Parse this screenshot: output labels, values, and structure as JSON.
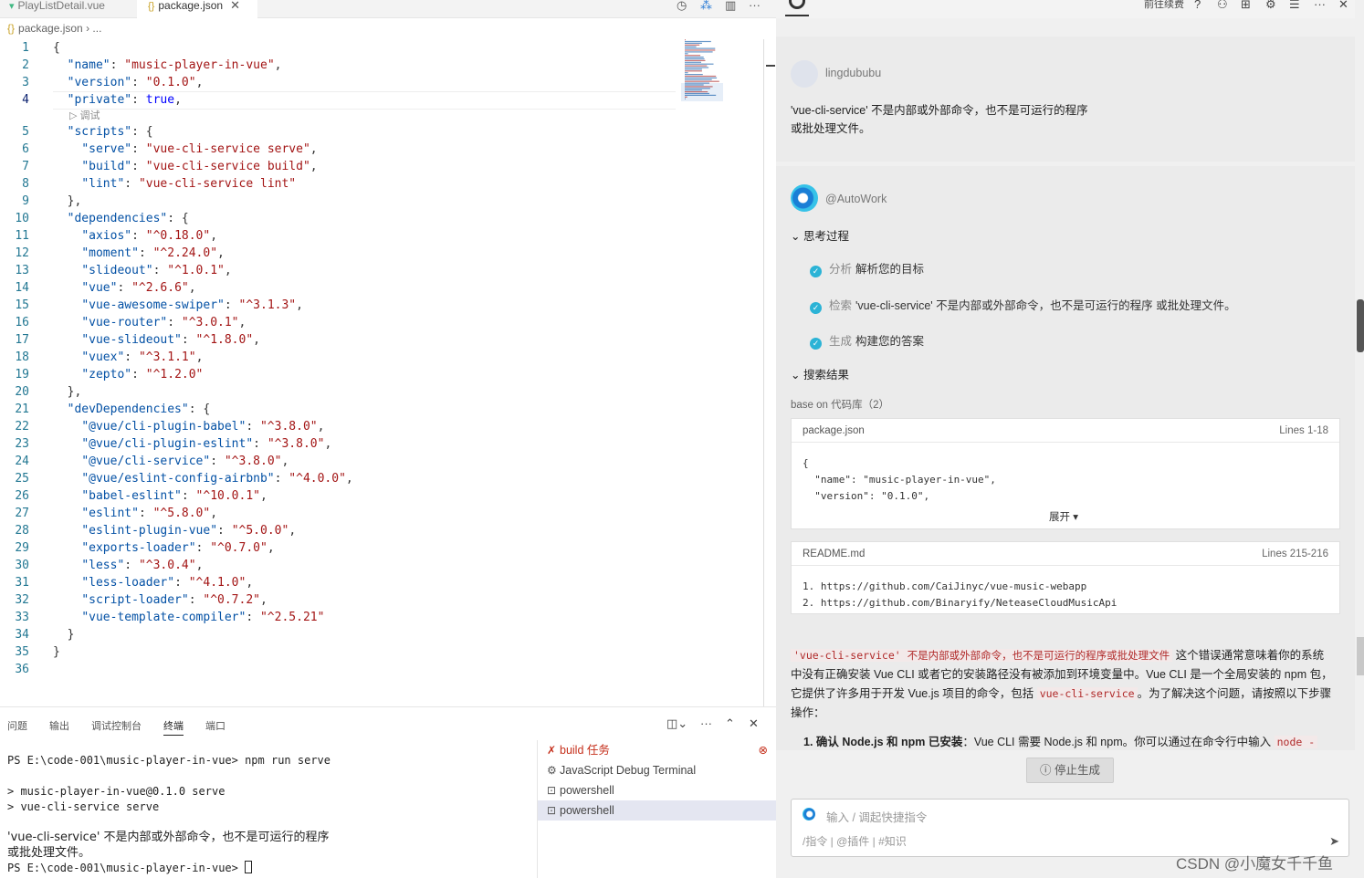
{
  "editor": {
    "tabs": [
      {
        "label": "PlayListDetail.vue",
        "icon": "vue-file-icon"
      },
      {
        "label": "package.json",
        "icon": "json-file-icon",
        "active": true
      }
    ],
    "breadcrumb": {
      "file": "package.json",
      "rest": "..."
    },
    "codelens": "调试",
    "lines": [
      {
        "n": "1",
        "parts": [
          [
            "p",
            "{"
          ]
        ]
      },
      {
        "n": "2",
        "parts": [
          [
            "p",
            "  "
          ],
          [
            "k",
            "\"name\""
          ],
          [
            "p",
            ": "
          ],
          [
            "s",
            "\"music-player-in-vue\""
          ],
          [
            "p",
            ","
          ]
        ]
      },
      {
        "n": "3",
        "parts": [
          [
            "p",
            "  "
          ],
          [
            "k",
            "\"version\""
          ],
          [
            "p",
            ": "
          ],
          [
            "s",
            "\"0.1.0\""
          ],
          [
            "p",
            ","
          ]
        ]
      },
      {
        "n": "4",
        "parts": [
          [
            "p",
            "  "
          ],
          [
            "k",
            "\"private\""
          ],
          [
            "p",
            ": "
          ],
          [
            "v",
            "true"
          ],
          [
            "p",
            ","
          ]
        ]
      },
      {
        "n": "5",
        "parts": [
          [
            "p",
            "  "
          ],
          [
            "k",
            "\"scripts\""
          ],
          [
            "p",
            ": {"
          ]
        ]
      },
      {
        "n": "6",
        "parts": [
          [
            "p",
            "    "
          ],
          [
            "k",
            "\"serve\""
          ],
          [
            "p",
            ": "
          ],
          [
            "s",
            "\"vue-cli-service serve\""
          ],
          [
            "p",
            ","
          ]
        ]
      },
      {
        "n": "7",
        "parts": [
          [
            "p",
            "    "
          ],
          [
            "k",
            "\"build\""
          ],
          [
            "p",
            ": "
          ],
          [
            "s",
            "\"vue-cli-service build\""
          ],
          [
            "p",
            ","
          ]
        ]
      },
      {
        "n": "8",
        "parts": [
          [
            "p",
            "    "
          ],
          [
            "k",
            "\"lint\""
          ],
          [
            "p",
            ": "
          ],
          [
            "s",
            "\"vue-cli-service lint\""
          ]
        ]
      },
      {
        "n": "9",
        "parts": [
          [
            "p",
            "  },"
          ]
        ]
      },
      {
        "n": "10",
        "parts": [
          [
            "p",
            "  "
          ],
          [
            "k",
            "\"dependencies\""
          ],
          [
            "p",
            ": {"
          ]
        ]
      },
      {
        "n": "11",
        "parts": [
          [
            "p",
            "    "
          ],
          [
            "k",
            "\"axios\""
          ],
          [
            "p",
            ": "
          ],
          [
            "s",
            "\"^0.18.0\""
          ],
          [
            "p",
            ","
          ]
        ]
      },
      {
        "n": "12",
        "parts": [
          [
            "p",
            "    "
          ],
          [
            "k",
            "\"moment\""
          ],
          [
            "p",
            ": "
          ],
          [
            "s",
            "\"^2.24.0\""
          ],
          [
            "p",
            ","
          ]
        ]
      },
      {
        "n": "13",
        "parts": [
          [
            "p",
            "    "
          ],
          [
            "k",
            "\"slideout\""
          ],
          [
            "p",
            ": "
          ],
          [
            "s",
            "\"^1.0.1\""
          ],
          [
            "p",
            ","
          ]
        ]
      },
      {
        "n": "14",
        "parts": [
          [
            "p",
            "    "
          ],
          [
            "k",
            "\"vue\""
          ],
          [
            "p",
            ": "
          ],
          [
            "s",
            "\"^2.6.6\""
          ],
          [
            "p",
            ","
          ]
        ]
      },
      {
        "n": "15",
        "parts": [
          [
            "p",
            "    "
          ],
          [
            "k",
            "\"vue-awesome-swiper\""
          ],
          [
            "p",
            ": "
          ],
          [
            "s",
            "\"^3.1.3\""
          ],
          [
            "p",
            ","
          ]
        ]
      },
      {
        "n": "16",
        "parts": [
          [
            "p",
            "    "
          ],
          [
            "k",
            "\"vue-router\""
          ],
          [
            "p",
            ": "
          ],
          [
            "s",
            "\"^3.0.1\""
          ],
          [
            "p",
            ","
          ]
        ]
      },
      {
        "n": "17",
        "parts": [
          [
            "p",
            "    "
          ],
          [
            "k",
            "\"vue-slideout\""
          ],
          [
            "p",
            ": "
          ],
          [
            "s",
            "\"^1.8.0\""
          ],
          [
            "p",
            ","
          ]
        ]
      },
      {
        "n": "18",
        "parts": [
          [
            "p",
            "    "
          ],
          [
            "k",
            "\"vuex\""
          ],
          [
            "p",
            ": "
          ],
          [
            "s",
            "\"^3.1.1\""
          ],
          [
            "p",
            ","
          ]
        ]
      },
      {
        "n": "19",
        "parts": [
          [
            "p",
            "    "
          ],
          [
            "k",
            "\"zepto\""
          ],
          [
            "p",
            ": "
          ],
          [
            "s",
            "\"^1.2.0\""
          ]
        ]
      },
      {
        "n": "20",
        "parts": [
          [
            "p",
            "  },"
          ]
        ]
      },
      {
        "n": "21",
        "parts": [
          [
            "p",
            "  "
          ],
          [
            "k",
            "\"devDependencies\""
          ],
          [
            "p",
            ": {"
          ]
        ]
      },
      {
        "n": "22",
        "parts": [
          [
            "p",
            "    "
          ],
          [
            "k",
            "\"@vue/cli-plugin-babel\""
          ],
          [
            "p",
            ": "
          ],
          [
            "s",
            "\"^3.8.0\""
          ],
          [
            "p",
            ","
          ]
        ]
      },
      {
        "n": "23",
        "parts": [
          [
            "p",
            "    "
          ],
          [
            "k",
            "\"@vue/cli-plugin-eslint\""
          ],
          [
            "p",
            ": "
          ],
          [
            "s",
            "\"^3.8.0\""
          ],
          [
            "p",
            ","
          ]
        ]
      },
      {
        "n": "24",
        "parts": [
          [
            "p",
            "    "
          ],
          [
            "k",
            "\"@vue/cli-service\""
          ],
          [
            "p",
            ": "
          ],
          [
            "s",
            "\"^3.8.0\""
          ],
          [
            "p",
            ","
          ]
        ]
      },
      {
        "n": "25",
        "parts": [
          [
            "p",
            "    "
          ],
          [
            "k",
            "\"@vue/eslint-config-airbnb\""
          ],
          [
            "p",
            ": "
          ],
          [
            "s",
            "\"^4.0.0\""
          ],
          [
            "p",
            ","
          ]
        ]
      },
      {
        "n": "26",
        "parts": [
          [
            "p",
            "    "
          ],
          [
            "k",
            "\"babel-eslint\""
          ],
          [
            "p",
            ": "
          ],
          [
            "s",
            "\"^10.0.1\""
          ],
          [
            "p",
            ","
          ]
        ]
      },
      {
        "n": "27",
        "parts": [
          [
            "p",
            "    "
          ],
          [
            "k",
            "\"eslint\""
          ],
          [
            "p",
            ": "
          ],
          [
            "s",
            "\"^5.8.0\""
          ],
          [
            "p",
            ","
          ]
        ]
      },
      {
        "n": "28",
        "parts": [
          [
            "p",
            "    "
          ],
          [
            "k",
            "\"eslint-plugin-vue\""
          ],
          [
            "p",
            ": "
          ],
          [
            "s",
            "\"^5.0.0\""
          ],
          [
            "p",
            ","
          ]
        ]
      },
      {
        "n": "29",
        "parts": [
          [
            "p",
            "    "
          ],
          [
            "k",
            "\"exports-loader\""
          ],
          [
            "p",
            ": "
          ],
          [
            "s",
            "\"^0.7.0\""
          ],
          [
            "p",
            ","
          ]
        ]
      },
      {
        "n": "30",
        "parts": [
          [
            "p",
            "    "
          ],
          [
            "k",
            "\"less\""
          ],
          [
            "p",
            ": "
          ],
          [
            "s",
            "\"^3.0.4\""
          ],
          [
            "p",
            ","
          ]
        ]
      },
      {
        "n": "31",
        "parts": [
          [
            "p",
            "    "
          ],
          [
            "k",
            "\"less-loader\""
          ],
          [
            "p",
            ": "
          ],
          [
            "s",
            "\"^4.1.0\""
          ],
          [
            "p",
            ","
          ]
        ]
      },
      {
        "n": "32",
        "parts": [
          [
            "p",
            "    "
          ],
          [
            "k",
            "\"script-loader\""
          ],
          [
            "p",
            ": "
          ],
          [
            "s",
            "\"^0.7.2\""
          ],
          [
            "p",
            ","
          ]
        ]
      },
      {
        "n": "33",
        "parts": [
          [
            "p",
            "    "
          ],
          [
            "k",
            "\"vue-template-compiler\""
          ],
          [
            "p",
            ": "
          ],
          [
            "s",
            "\"^2.5.21\""
          ]
        ]
      },
      {
        "n": "34",
        "parts": [
          [
            "p",
            "  }"
          ]
        ]
      },
      {
        "n": "35",
        "parts": [
          [
            "p",
            "}"
          ]
        ]
      },
      {
        "n": "36",
        "parts": []
      }
    ]
  },
  "panel": {
    "tabs": [
      "问题",
      "输出",
      "调试控制台",
      "终端",
      "端口"
    ],
    "active_tab": "终端",
    "terminal_lines": [
      "PS E:\\code-001\\music-player-in-vue> npm run serve",
      "> music-player-in-vue@0.1.0 serve",
      "> vue-cli-service serve",
      "'vue-cli-service' 不是内部或外部命令，也不是可运行的程序",
      "或批处理文件。",
      "PS E:\\code-001\\music-player-in-vue> "
    ],
    "terminal_list": [
      {
        "label": "build  任务",
        "icon": "tools-icon"
      },
      {
        "label": "JavaScript Debug Terminal",
        "icon": "debug-gear-icon"
      },
      {
        "label": "powershell",
        "icon": "terminal-icon"
      },
      {
        "label": "powershell",
        "icon": "terminal-icon",
        "selected": true
      }
    ]
  },
  "chat": {
    "top_label": "前往续费",
    "user": {
      "name": "lingdububu",
      "message_line1": "'vue-cli-service' 不是内部或外部命令，也不是可运行的程序",
      "message_line2": "或批处理文件。"
    },
    "bot": {
      "name": "@AutoWork",
      "thinking_title": "思考过程",
      "steps": [
        {
          "label": "分析",
          "text": "解析您的目标"
        },
        {
          "label": "检索",
          "text": "'vue-cli-service' 不是内部或外部命令，也不是可运行的程序 或批处理文件。"
        },
        {
          "label": "生成",
          "text": "构建您的答案"
        }
      ],
      "search_title": "搜索结果",
      "base_on": "base on 代码库（2）",
      "results": [
        {
          "file": "package.json",
          "lines": "Lines 1-18",
          "code": [
            "{",
            "  \"name\": \"music-player-in-vue\",",
            "  \"version\": \"0.1.0\","
          ],
          "expand": "展开 ▾"
        },
        {
          "file": "README.md",
          "lines": "Lines 215-216",
          "code": [
            "1. https://github.com/CaiJinyc/vue-music-webapp",
            "2. https://github.com/Binaryify/NeteaseCloudMusicApi"
          ]
        }
      ],
      "answer": {
        "code1": "'vue-cli-service' 不是内部或外部命令，也不是可运行的程序或批处理文件",
        "text1": " 这个错误通常意味着你的系统中没有正确安装 Vue CLI 或者它的安装路径没有被添加到环境变量中。Vue CLI 是一个全局安装的 npm 包，它提供了许多用于开发 Vue.js 项目的命令，包括 ",
        "code2": "vue-cli-service",
        "text2": "。为了解决这个问题，请按照以下步骤操作：",
        "step1_bold": "1. 确认 Node.js 和 npm 已安装",
        "step1_text": "：Vue CLI 需要 Node.js 和 npm。你可以通过在命令行中输入 ",
        "step1_code": "node -"
      }
    },
    "stop_button": "停止生成",
    "input": {
      "placeholder": "输入 / 调起快捷指令",
      "tools": "/指令  | @插件  | #知识"
    }
  },
  "watermark": "CSDN @小魔女千千鱼",
  "colors": {
    "accent": "#2bb3d6",
    "key": "#a31515",
    "string": "#a31515",
    "bool": "#0000ff",
    "error": "#c52f1b"
  }
}
